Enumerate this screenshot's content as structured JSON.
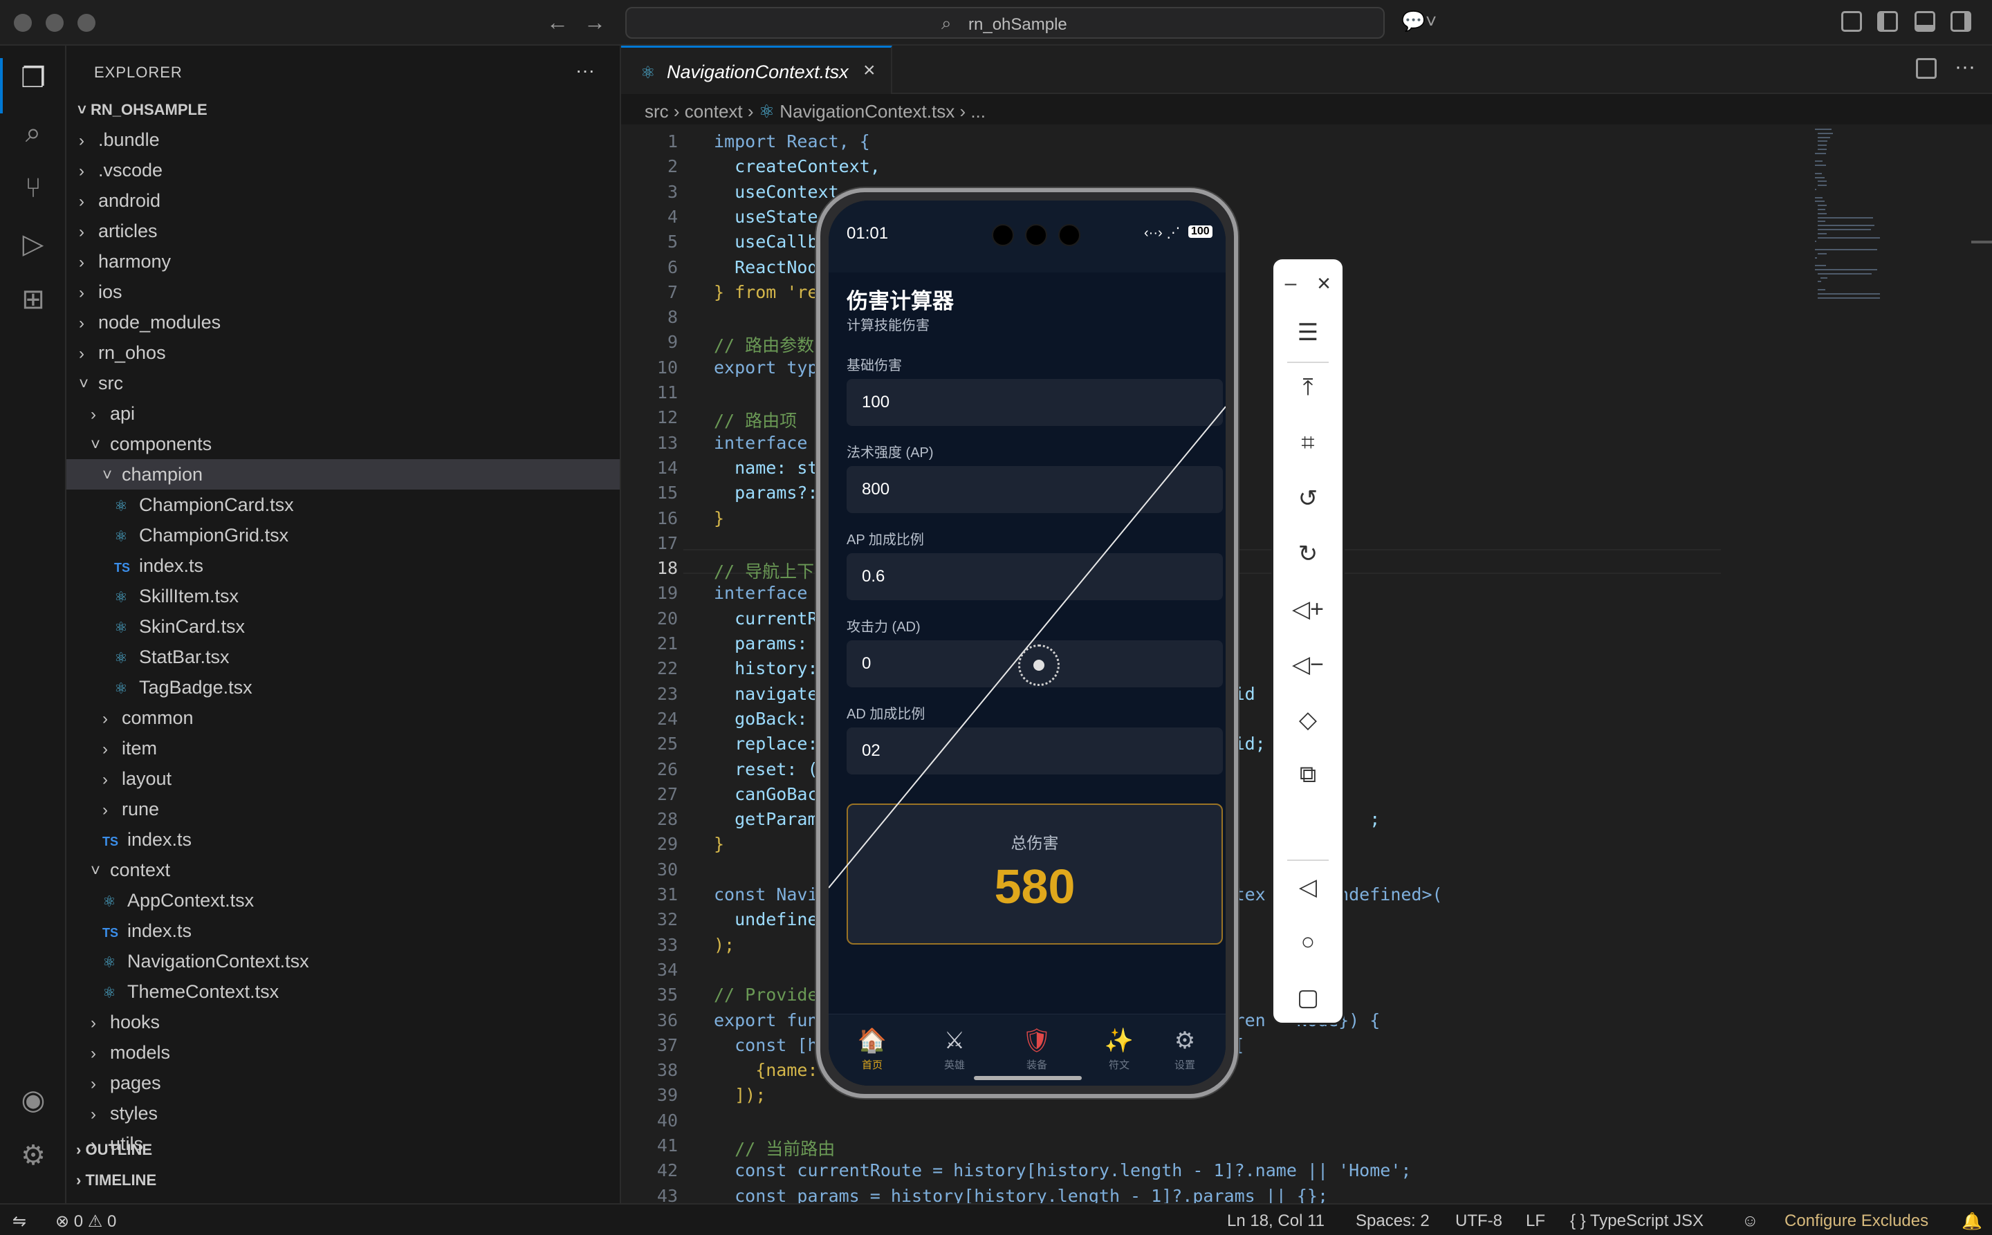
{
  "window": {
    "search_label": "rn_ohSample"
  },
  "sidebar": {
    "title": "EXPLORER",
    "more": "···",
    "project": "RN_OHSAMPLE",
    "tree": [
      {
        "label": ".bundle",
        "depth": 1,
        "type": "folder",
        "open": false
      },
      {
        "label": ".vscode",
        "depth": 1,
        "type": "folder",
        "open": false
      },
      {
        "label": "android",
        "depth": 1,
        "type": "folder",
        "open": false
      },
      {
        "label": "articles",
        "depth": 1,
        "type": "folder",
        "open": false
      },
      {
        "label": "harmony",
        "depth": 1,
        "type": "folder",
        "open": false
      },
      {
        "label": "ios",
        "depth": 1,
        "type": "folder",
        "open": false
      },
      {
        "label": "node_modules",
        "depth": 1,
        "type": "folder",
        "open": false
      },
      {
        "label": "rn_ohos",
        "depth": 1,
        "type": "folder",
        "open": false
      },
      {
        "label": "src",
        "depth": 1,
        "type": "folder",
        "open": true
      },
      {
        "label": "api",
        "depth": 2,
        "type": "folder",
        "open": false
      },
      {
        "label": "components",
        "depth": 2,
        "type": "folder",
        "open": true
      },
      {
        "label": "champion",
        "depth": 3,
        "type": "folder",
        "open": true,
        "selected": true
      },
      {
        "label": "ChampionCard.tsx",
        "depth": 4,
        "type": "react"
      },
      {
        "label": "ChampionGrid.tsx",
        "depth": 4,
        "type": "react"
      },
      {
        "label": "index.ts",
        "depth": 4,
        "type": "ts"
      },
      {
        "label": "SkillItem.tsx",
        "depth": 4,
        "type": "react"
      },
      {
        "label": "SkinCard.tsx",
        "depth": 4,
        "type": "react"
      },
      {
        "label": "StatBar.tsx",
        "depth": 4,
        "type": "react"
      },
      {
        "label": "TagBadge.tsx",
        "depth": 4,
        "type": "react"
      },
      {
        "label": "common",
        "depth": 3,
        "type": "folder",
        "open": false
      },
      {
        "label": "item",
        "depth": 3,
        "type": "folder",
        "open": false
      },
      {
        "label": "layout",
        "depth": 3,
        "type": "folder",
        "open": false
      },
      {
        "label": "rune",
        "depth": 3,
        "type": "folder",
        "open": false
      },
      {
        "label": "index.ts",
        "depth": 3,
        "type": "ts"
      },
      {
        "label": "context",
        "depth": 2,
        "type": "folder",
        "open": true
      },
      {
        "label": "AppContext.tsx",
        "depth": 3,
        "type": "react"
      },
      {
        "label": "index.ts",
        "depth": 3,
        "type": "ts"
      },
      {
        "label": "NavigationContext.tsx",
        "depth": 3,
        "type": "react"
      },
      {
        "label": "ThemeContext.tsx",
        "depth": 3,
        "type": "react"
      },
      {
        "label": "hooks",
        "depth": 2,
        "type": "folder",
        "open": false
      },
      {
        "label": "models",
        "depth": 2,
        "type": "folder",
        "open": false
      },
      {
        "label": "pages",
        "depth": 2,
        "type": "folder",
        "open": false
      },
      {
        "label": "styles",
        "depth": 2,
        "type": "folder",
        "open": false
      },
      {
        "label": "utils",
        "depth": 2,
        "type": "folder",
        "open": false
      }
    ],
    "outline": "OUTLINE",
    "timeline": "TIMELINE"
  },
  "editor": {
    "tab_label": "NavigationContext.tsx",
    "breadcrumb": [
      "src",
      "context",
      "NavigationContext.tsx",
      "..."
    ],
    "current_line": 18,
    "lines": [
      "import React, {",
      "  createContext,",
      "  useContext,",
      "  useState,",
      "  useCallb",
      "  ReactNod",
      "} from 're",
      "",
      "// 路由参数",
      "export typ",
      "",
      "// 路由项",
      "interface",
      "  name: st",
      "  params?:",
      "}",
      "",
      "// 导航上下",
      "interface",
      "  currentR",
      "  params:",
      "  history:",
      "  navigate                                       oid",
      "  goBack:",
      "  replace:                                       oid;",
      "  reset: (                                       ;",
      "  canGoBac",
      "  getParam                                      un             ;",
      "}",
      "",
      "const Navi                                       ntex      undefined>(",
      "  undefine",
      ");",
      "",
      "// Provide",
      "export fun                                       dren   Node}) {",
      "  const [h                                       ([",
      "    {name:",
      "  ]);",
      "",
      "  // 当前路由",
      "  const currentRoute = history[history.length - 1]?.name || 'Home';",
      "  const params = history[history.length - 1]?.params || {};"
    ]
  },
  "status": {
    "errors": "0",
    "warnings": "0",
    "position": "Ln 18, Col 11",
    "spaces": "Spaces: 2",
    "encoding": "UTF-8",
    "eol": "LF",
    "language": "{ } TypeScript JSX",
    "configure": "Configure Excludes"
  },
  "phone": {
    "time": "01:01",
    "battery": "100",
    "app_title": "伤害计算器",
    "app_subtitle": "计算技能伤害",
    "fields": [
      {
        "label": "基础伤害",
        "value": "100"
      },
      {
        "label": "法术强度 (AP)",
        "value": "800"
      },
      {
        "label": "AP 加成比例",
        "value": "0.6"
      },
      {
        "label": "攻击力 (AD)",
        "value": "0"
      },
      {
        "label": "AD 加成比例",
        "value": "02"
      }
    ],
    "result_label": "总伤害",
    "result_value": "580",
    "nav": [
      {
        "icon": "🏠",
        "label": "首页"
      },
      {
        "icon": "⚔",
        "label": "英雄"
      },
      {
        "icon": "🛡",
        "label": "装备"
      },
      {
        "icon": "✨",
        "label": "符文"
      },
      {
        "icon": "⚙",
        "label": "设置"
      }
    ]
  },
  "emulator_tools": [
    "minimize",
    "close",
    "menu",
    "scroll-top",
    "crop",
    "rotate-left",
    "rotate-right",
    "volume-up",
    "volume-down",
    "fold",
    "multi-device",
    "back",
    "home",
    "overview"
  ]
}
